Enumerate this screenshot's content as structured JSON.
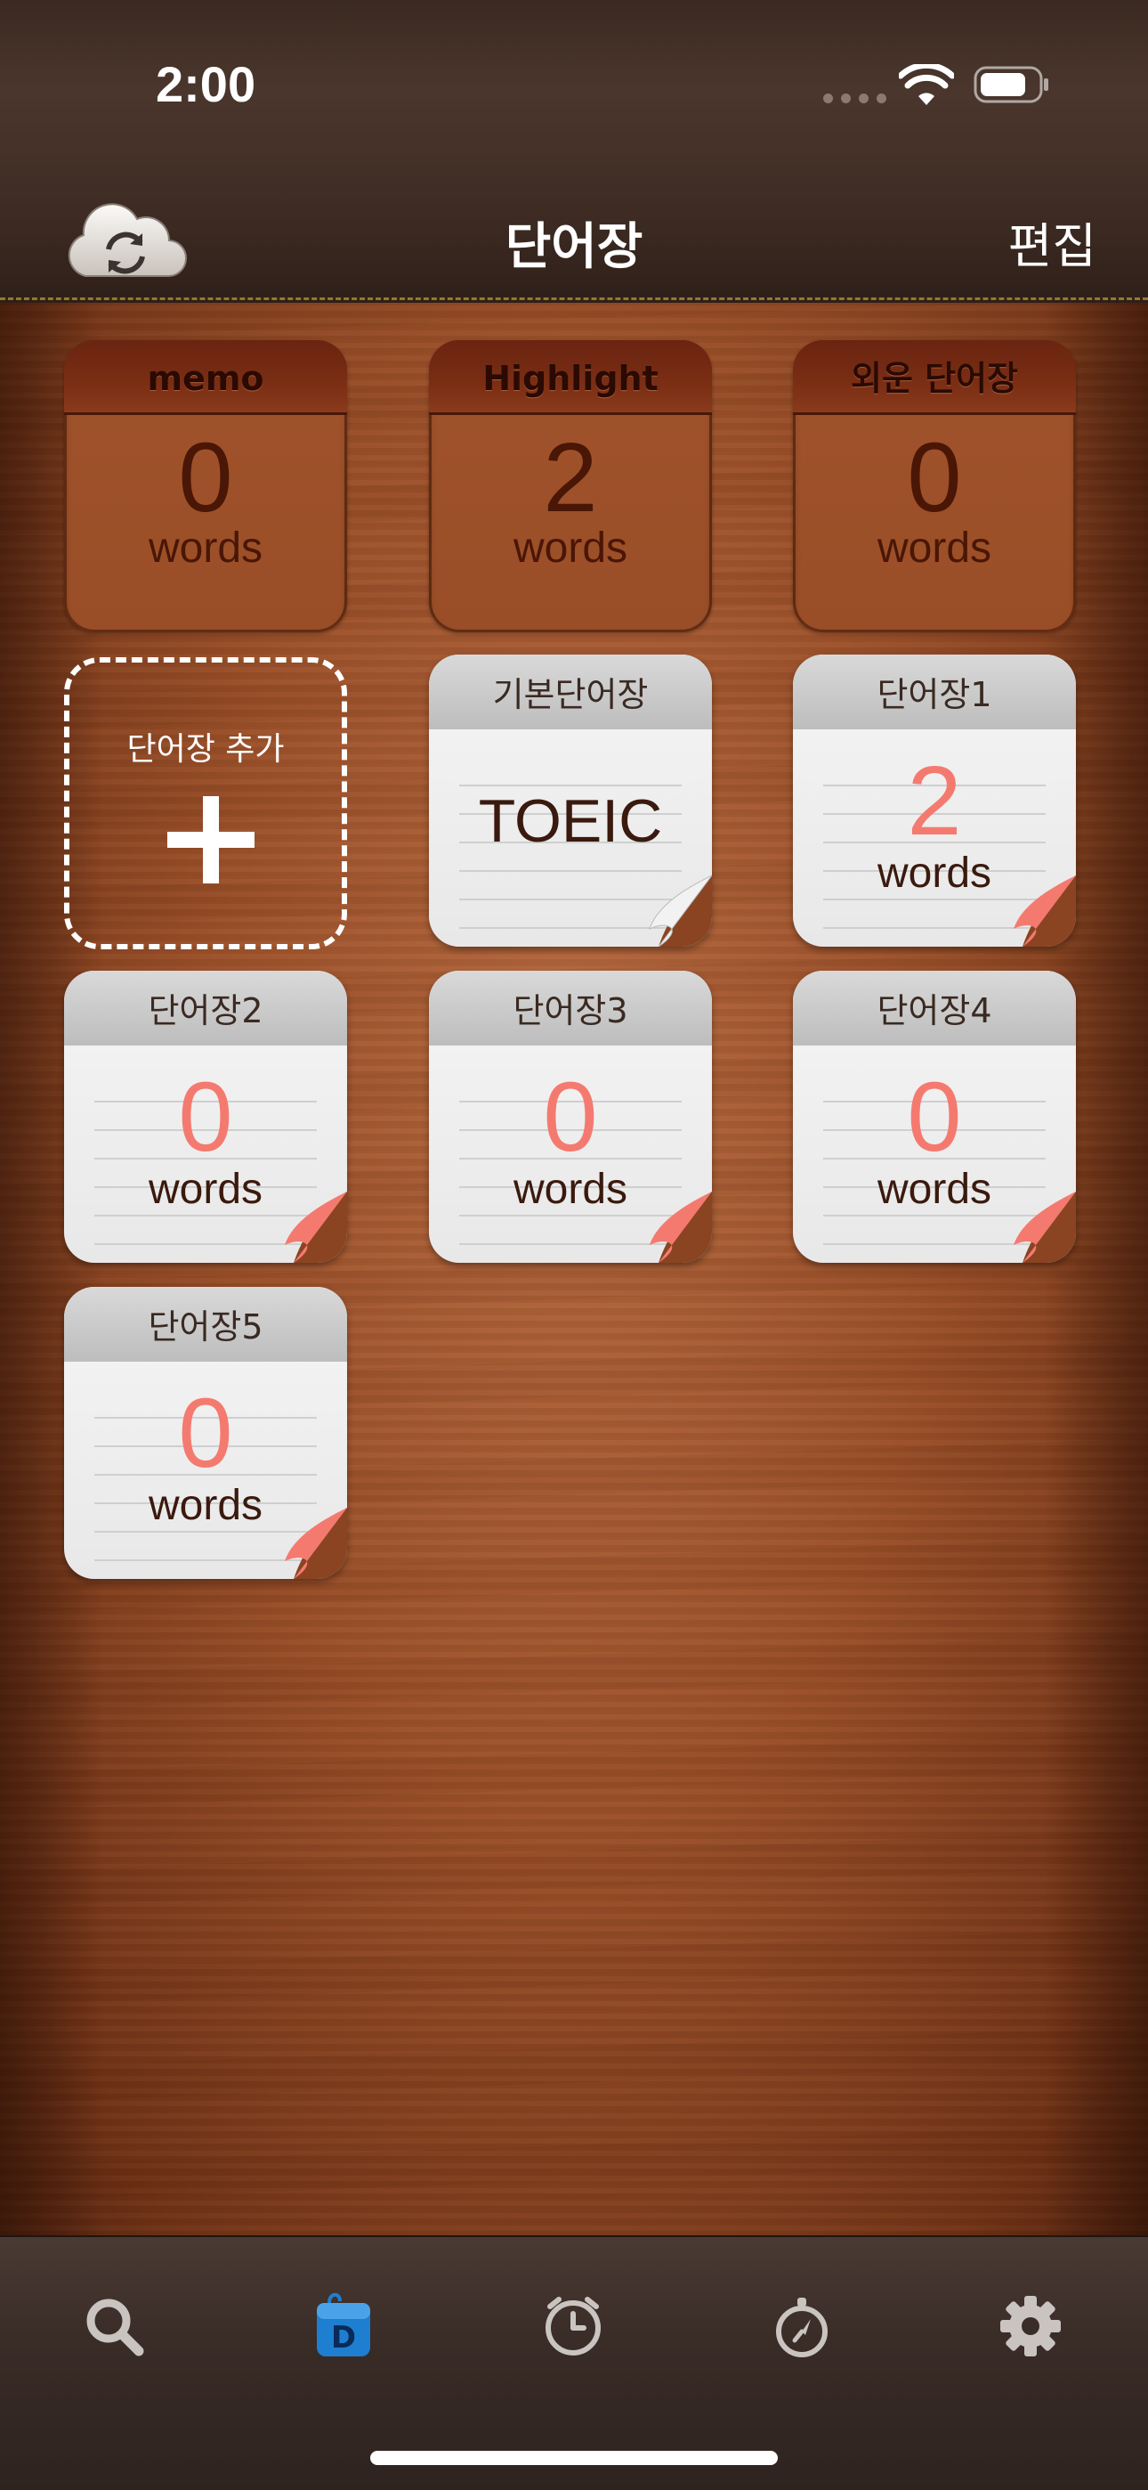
{
  "status_bar": {
    "time": "2:00"
  },
  "nav": {
    "title": "단어장",
    "edit_label": "편집"
  },
  "system_lists": [
    {
      "name": "memo",
      "count": "0",
      "unit": "words"
    },
    {
      "name": "Highlight",
      "count": "2",
      "unit": "words"
    },
    {
      "name": "외운 단어장",
      "count": "0",
      "unit": "words"
    }
  ],
  "add_list": {
    "label": "단어장 추가"
  },
  "wordbooks": [
    {
      "name": "기본단어장",
      "content": "TOEIC"
    },
    {
      "name": "단어장1",
      "count": "2",
      "unit": "words"
    },
    {
      "name": "단어장2",
      "count": "0",
      "unit": "words"
    },
    {
      "name": "단어장3",
      "count": "0",
      "unit": "words"
    },
    {
      "name": "단어장4",
      "count": "0",
      "unit": "words"
    },
    {
      "name": "단어장5",
      "count": "0",
      "unit": "words"
    }
  ],
  "tabbar": {
    "tabs": [
      {
        "icon": "search-icon"
      },
      {
        "icon": "dictionary-icon",
        "active": true
      },
      {
        "icon": "clock-icon"
      },
      {
        "icon": "stopwatch-icon"
      },
      {
        "icon": "gear-icon"
      }
    ]
  },
  "colors": {
    "count_accent": "#f47a70",
    "header_bg": "#3e2c24",
    "wood": "#9a5029",
    "active_tab": "#1e7fd0"
  }
}
